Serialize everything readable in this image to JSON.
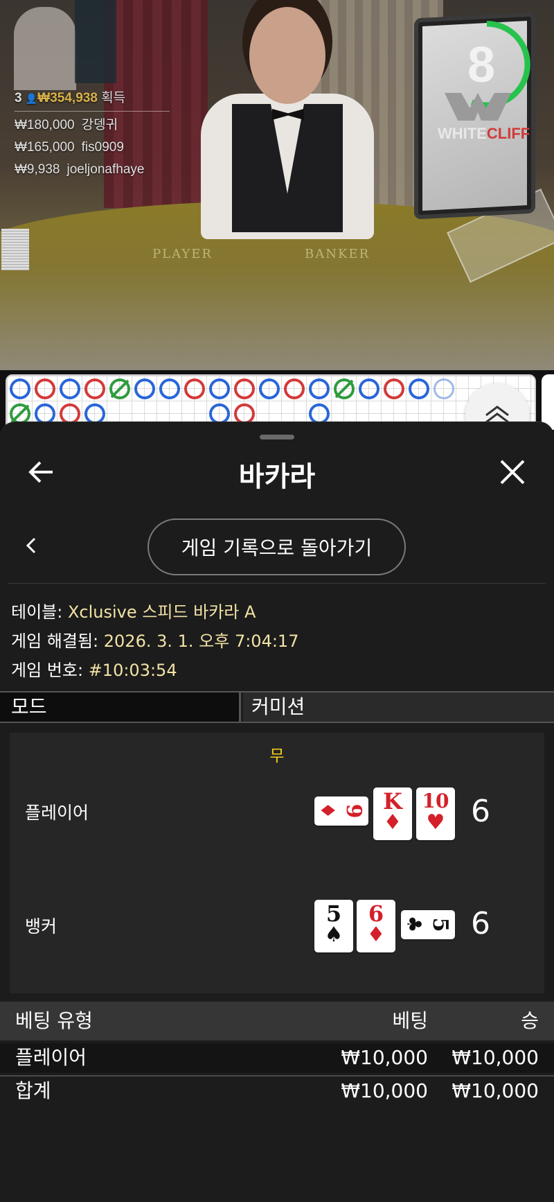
{
  "stream": {
    "winners_count": "3",
    "winners_total": "₩354,938",
    "winners_label": "획득",
    "winners": [
      {
        "amount": "₩180,000",
        "name": "강뎅귀"
      },
      {
        "amount": "₩165,000",
        "name": "fis0909"
      },
      {
        "amount": "₩9,938",
        "name": "joeljonafhaye"
      }
    ],
    "timer": "8",
    "brand_a": "WHITE",
    "brand_b": "CLIFF",
    "felt_player": "PLAYER",
    "felt_banker": "BANKER"
  },
  "road": {
    "beads": [
      "P",
      "B",
      "P",
      "B",
      "T",
      "P",
      "P",
      "B",
      "P",
      "B",
      "P",
      "B",
      "P",
      "T",
      "P",
      "B",
      "P",
      "T",
      "P",
      "B",
      "P",
      "P",
      "B",
      "P",
      "T",
      "P"
    ]
  },
  "panel": {
    "title": "바카라",
    "back_icon": "arrow-left-icon",
    "close_icon": "close-icon",
    "return_button": "게임 기록으로 돌아가기",
    "table_label": "테이블:",
    "table_value": "Xclusive 스피드 바카라 A",
    "resolved_label": "게임 해결됨:",
    "resolved_value": "2026. 3. 1. 오후 7:04:17",
    "game_no_label": "게임 번호:",
    "game_no_value": "#10:03:54",
    "tab_mode": "모드",
    "tab_commission": "커미션"
  },
  "result": {
    "outcome": "무",
    "player_label": "플레이어",
    "player_score": "6",
    "player_cards": [
      {
        "rank": "9",
        "suit": "♦",
        "color": "red"
      },
      {
        "rank": "K",
        "suit": "♦",
        "color": "red"
      },
      {
        "rank": "10",
        "suit": "♥",
        "color": "red"
      }
    ],
    "banker_label": "뱅커",
    "banker_score": "6",
    "banker_cards": [
      {
        "rank": "5",
        "suit": "♠",
        "color": "black"
      },
      {
        "rank": "6",
        "suit": "♦",
        "color": "red"
      },
      {
        "rank": "5",
        "suit": "♣",
        "color": "black"
      }
    ]
  },
  "bets": {
    "headers": {
      "type": "베팅 유형",
      "bet": "베팅",
      "win": "승"
    },
    "rows": [
      {
        "type": "플레이어",
        "bet": "₩10,000",
        "win": "₩10,000"
      }
    ],
    "total": {
      "type": "합계",
      "bet": "₩10,000",
      "win": "₩10,000"
    }
  }
}
